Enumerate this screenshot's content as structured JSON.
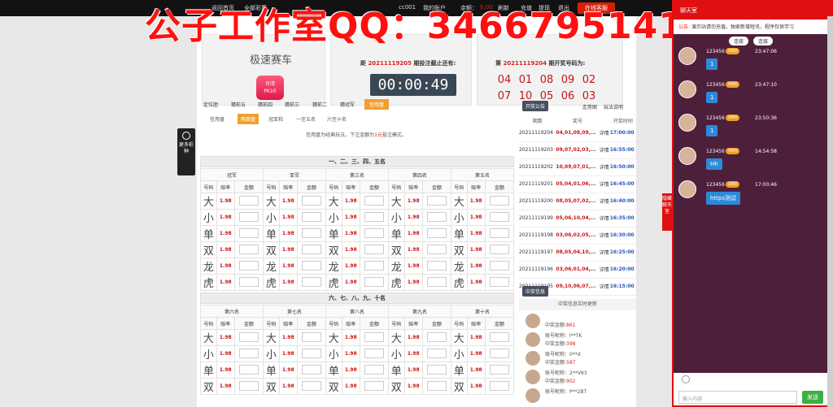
{
  "topbar": {
    "home": "返回首页",
    "reset": "全部彩票",
    "user": "cc001",
    "account": "我的账户",
    "balance_label": "余额：",
    "balance": "0.00",
    "refresh": "刷新",
    "recharge": "充值",
    "withdraw": "提现",
    "record": "退出",
    "online": "在线客服"
  },
  "watermark": "公子工作室QQ：3466795141",
  "game": {
    "name": "极速赛车",
    "logo_top": "台湾",
    "logo_bottom": "PK10"
  },
  "timer": {
    "label_prefix": "距",
    "issue": "20211119205",
    "label_suffix": "期投注截止还有:",
    "value": "00:00:49"
  },
  "result": {
    "prefix": "第",
    "issue": "20211119204",
    "suffix": "期开奖号码为:",
    "balls": [
      "04",
      "01",
      "08",
      "09",
      "02",
      "07",
      "10",
      "05",
      "06",
      "03"
    ]
  },
  "tabs": [
    "定位胆",
    "猜前五",
    "猜前四",
    "猜前三",
    "猜前二",
    "猜冠军",
    "信用盘"
  ],
  "subtabs": [
    "信用盘",
    "两面盘",
    "冠亚和",
    "一至五名",
    "六至十名"
  ],
  "notice": {
    "a": "信用盘为经典玩法，下注金额为",
    "b": "1元",
    "c": "投注模式。"
  },
  "section1": "一、二、三、四、五名",
  "section2": "六、七、八、九、十名",
  "positions1": [
    "冠军",
    "亚军",
    "第三名",
    "第四名",
    "第五名"
  ],
  "positions2": [
    "第六名",
    "第七名",
    "第八名",
    "第九名",
    "第十名"
  ],
  "colheads": [
    "号码",
    "赔率",
    "金额"
  ],
  "rows": [
    {
      "ch": "大",
      "odds": "1.98"
    },
    {
      "ch": "小",
      "odds": "1.98"
    },
    {
      "ch": "单",
      "odds": "1.98"
    },
    {
      "ch": "双",
      "odds": "1.98"
    },
    {
      "ch": "龙",
      "odds": "1.98"
    },
    {
      "ch": "虎",
      "odds": "1.98"
    }
  ],
  "rows2": [
    {
      "ch": "大",
      "odds": "1.98"
    },
    {
      "ch": "小",
      "odds": "1.98"
    },
    {
      "ch": "单",
      "odds": "1.98"
    },
    {
      "ch": "双",
      "odds": "1.98"
    }
  ],
  "more": "更多彩种",
  "right": {
    "draw_btn": "开奖公告",
    "trend": "走势图",
    "rules": "玩法说明",
    "heads": [
      "期数",
      "奖号",
      "",
      "开奖时间"
    ],
    "history": [
      {
        "issue": "20211119204",
        "nums": "04,01,08,09,...",
        "detail": "详情",
        "time": "17:00:00"
      },
      {
        "issue": "20211119203",
        "nums": "09,07,02,03,...",
        "detail": "详情",
        "time": "16:55:00"
      },
      {
        "issue": "20211119202",
        "nums": "10,09,07,01,...",
        "detail": "详情",
        "time": "16:50:00"
      },
      {
        "issue": "20211119201",
        "nums": "05,04,01,06,...",
        "detail": "详情",
        "time": "16:45:00"
      },
      {
        "issue": "20211119200",
        "nums": "08,05,07,02,...",
        "detail": "详情",
        "time": "16:40:00"
      },
      {
        "issue": "20211119199",
        "nums": "05,06,10,04,...",
        "detail": "详情",
        "time": "16:35:00"
      },
      {
        "issue": "20211119198",
        "nums": "03,06,02,05,...",
        "detail": "详情",
        "time": "16:30:00"
      },
      {
        "issue": "20211119197",
        "nums": "08,05,04,10,...",
        "detail": "详情",
        "time": "16:25:00"
      },
      {
        "issue": "20211119196",
        "nums": "03,06,01,04,...",
        "detail": "详情",
        "time": "16:20:00"
      },
      {
        "issue": "20211119195",
        "nums": "09,10,06,07,...",
        "detail": "详情",
        "time": "16:15:00"
      }
    ],
    "winners_btn": "中奖信息",
    "winners_sub": "中奖信息实时更新",
    "winners": [
      {
        "name": "",
        "amount_label": "中奖金额:",
        "amount": "861"
      },
      {
        "name": "账号昵称：l**TK",
        "amount_label": "中奖金额:",
        "amount": "398"
      },
      {
        "name": "账号昵称：0**d",
        "amount_label": "中奖金额:",
        "amount": "587"
      },
      {
        "name": "账号昵称：2**V83",
        "amount_label": "中奖金额:",
        "amount": "902"
      },
      {
        "name": "账号昵称：P**2BT",
        "amount_label": "",
        "amount": ""
      }
    ]
  },
  "chat": {
    "title": "聊天室",
    "notice_label": "公告:",
    "notice": "演示站请勿充值，独家新增短讯，程序仅供学习",
    "pills": [
      "连接",
      "连接"
    ],
    "messages": [
      {
        "name": "123456",
        "vip": "VIP0",
        "time": "23:47:06",
        "text": "1"
      },
      {
        "name": "123456",
        "vip": "VIP0",
        "time": "23:47:10",
        "text": "1"
      },
      {
        "name": "123456",
        "vip": "VIP0",
        "time": "23:50:36",
        "text": "1"
      },
      {
        "name": "123456",
        "vip": "VIP0",
        "time": "14:54:58",
        "text": "Hh"
      },
      {
        "name": "123456",
        "vip": "VIP0",
        "time": "17:00:46",
        "text": "https测试"
      }
    ],
    "hide": "隐藏聊天室",
    "placeholder": "输入内容",
    "send": "发送"
  }
}
